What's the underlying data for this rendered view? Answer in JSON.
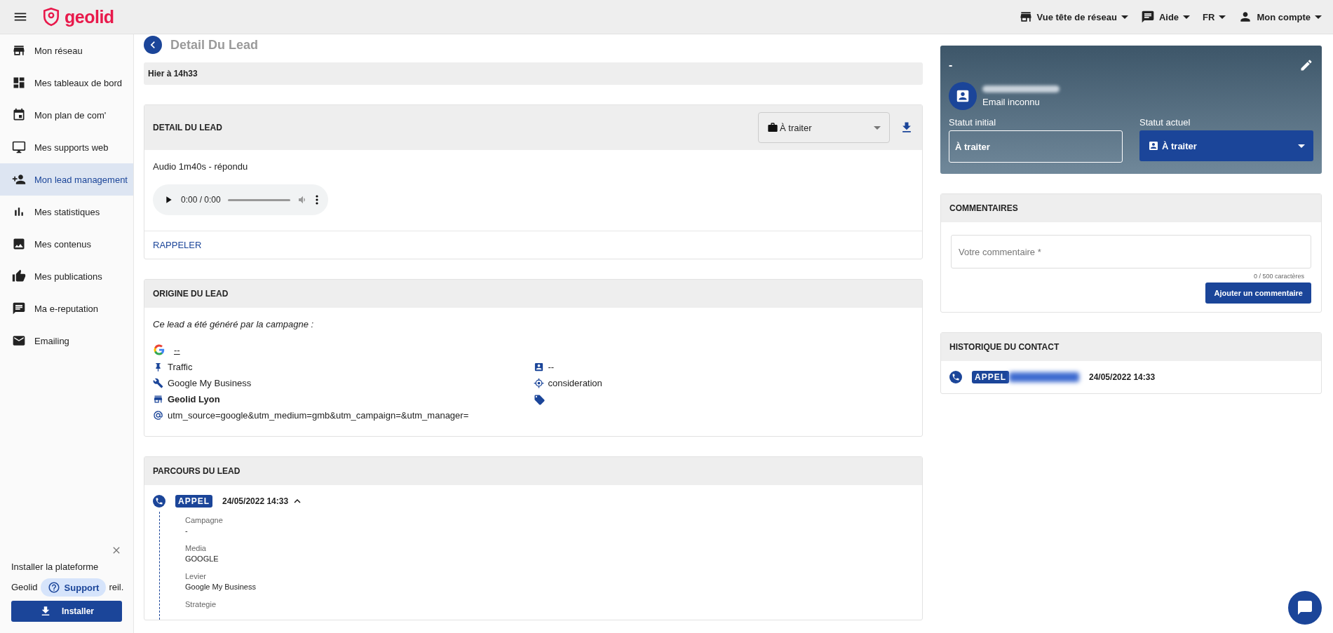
{
  "header": {
    "brand": "geolid",
    "menus": [
      {
        "kind": "network",
        "label": "Vue tête de réseau"
      },
      {
        "kind": "help",
        "label": "Aide"
      },
      {
        "kind": "language",
        "label": "FR"
      },
      {
        "kind": "account",
        "label": "Mon compte"
      }
    ]
  },
  "sidebar": {
    "items": [
      {
        "kind": "store",
        "label": "Mon réseau",
        "selected": false
      },
      {
        "kind": "dashboard",
        "label": "Mes tableaux de bord",
        "selected": false
      },
      {
        "kind": "calendar",
        "label": "Mon plan de com'",
        "selected": false
      },
      {
        "kind": "monitor",
        "label": "Mes supports web",
        "selected": false
      },
      {
        "kind": "person-add",
        "label": "Mon lead management",
        "selected": true
      },
      {
        "kind": "chart",
        "label": "Mes statistiques",
        "selected": false
      },
      {
        "kind": "image",
        "label": "Mes contenus",
        "selected": false
      },
      {
        "kind": "thumb",
        "label": "Mes publications",
        "selected": false
      },
      {
        "kind": "chat",
        "label": "Ma e-reputation",
        "selected": false
      },
      {
        "kind": "mail",
        "label": "Emailing",
        "selected": false
      }
    ],
    "install": {
      "line_1": "Installer la plateforme",
      "line_2_start": "Geolid",
      "line_2_end": "reil.",
      "support": "Support",
      "button": "Installer"
    }
  },
  "page": {
    "title": "Detail Du Lead",
    "date_bar": "Hier à 14h33"
  },
  "detail": {
    "title": "DETAIL DU LEAD",
    "status": "À traiter",
    "audio_label": "Audio 1m40s - répondu",
    "audio_time": "0:00 / 0:00",
    "link": "RAPPELER"
  },
  "origin": {
    "title": "ORIGINE DU LEAD",
    "intro": "Ce lead a été généré par la campagne :",
    "campaign": "--",
    "left": [
      {
        "kind": "objective",
        "text": "Traffic"
      },
      {
        "kind": "lever",
        "text": "Google My Business"
      },
      {
        "kind": "point_of_sale",
        "text": "Geolid Lyon"
      },
      {
        "kind": "tracking",
        "text": "utm_source=google&utm_medium=gmb&utm_campaign=&utm_manager="
      }
    ],
    "right": [
      {
        "kind": "contact",
        "text": "--"
      },
      {
        "kind": "target",
        "text": "consideration"
      },
      {
        "kind": "tag"
      }
    ]
  },
  "journey": {
    "title": "PARCOURS DU LEAD",
    "event": {
      "badge": "APPEL",
      "date": "24/05/2022 14:33",
      "expanded": true
    },
    "fields": [
      {
        "label": "Campagne",
        "value": "-"
      },
      {
        "label": "Media",
        "value": "GOOGLE"
      },
      {
        "label": "Levier",
        "value": "Google My Business"
      },
      {
        "label": "Strategie"
      }
    ]
  },
  "contact": {
    "name": "-",
    "email": "Email inconnu",
    "initial_label": "Statut initial",
    "initial_value": "À traiter",
    "current_label": "Statut actuel",
    "current_value": "À traiter"
  },
  "comments": {
    "title": "COMMENTAIRES",
    "placeholder": "Votre commentaire *",
    "counter": "0 / 500 caractères",
    "button": "Ajouter un commentaire"
  },
  "history": {
    "title": "HISTORIQUE DU CONTACT",
    "badge": "APPEL",
    "date": "24/05/2022 14:33"
  }
}
